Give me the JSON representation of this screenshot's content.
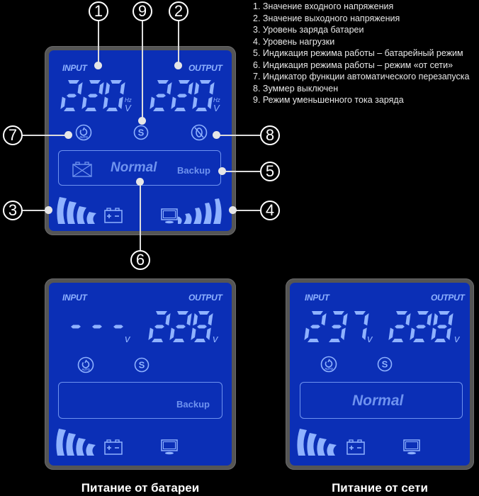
{
  "legend": {
    "items": [
      "1. Значение входного напряжения",
      "2. Значение выходного напряжения",
      "3. Уровень заряда батареи",
      "4. Уровень нагрузки",
      "5. Индикация режима работы – батарейный режим",
      "6. Индикация режима работы – режим «от сети»",
      "7. Индикатор функции автоматического перезапуска",
      "8. Зуммер выключен",
      "9. Режим уменьшенного тока заряда"
    ]
  },
  "callouts": [
    "1",
    "2",
    "3",
    "4",
    "5",
    "6",
    "7",
    "8",
    "9"
  ],
  "colors": {
    "lcd_bg": "#0b2fb6",
    "lcd_segment": "#8fb2ff",
    "lcd_dim": "#6f93ef",
    "bezel": "#555555"
  },
  "panels": {
    "main": {
      "input_label": "INPUT",
      "output_label": "OUTPUT",
      "input_value": "220",
      "output_value": "220",
      "unit_hz": "Hz",
      "unit_v": "V",
      "icons": [
        "auto-restart-icon",
        "s-mode-icon",
        "buzzer-off-icon"
      ],
      "mode_normal": "Normal",
      "mode_backup": "Backup",
      "battery_level_bars": 4,
      "load_level_bars": 5
    },
    "battery": {
      "input_label": "INPUT",
      "output_label": "OUTPUT",
      "input_value": "---",
      "output_value": "228",
      "unit_v": "v",
      "mode_backup": "Backup",
      "battery_level_bars": 4,
      "caption": "Питание от батареи"
    },
    "mains": {
      "input_label": "INPUT",
      "output_label": "OUTPUT",
      "input_value": "237",
      "output_value": "228",
      "unit_v": "v",
      "mode_normal": "Normal",
      "battery_level_bars": 4,
      "caption": "Питание от сети"
    }
  }
}
